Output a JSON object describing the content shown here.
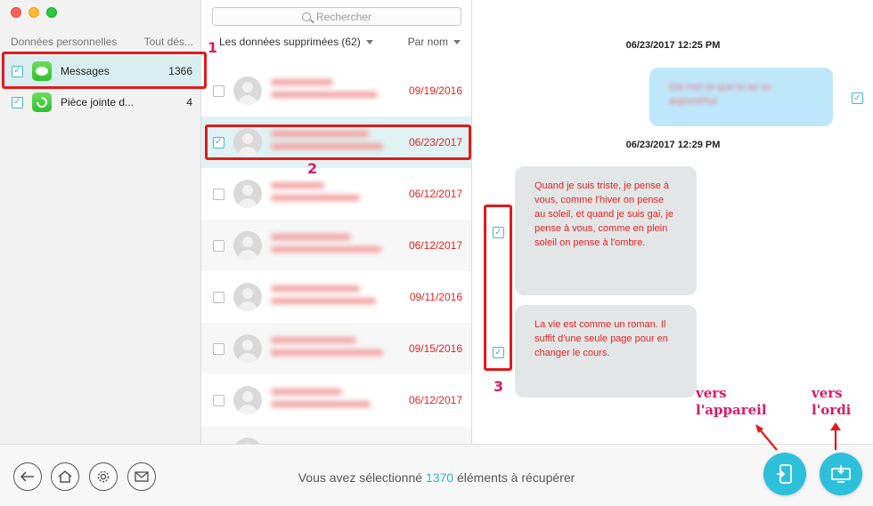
{
  "sidebar": {
    "header_left": "Données personnelles",
    "header_right": "Tout dés...",
    "items": [
      {
        "label": "Messages",
        "count": "1366"
      },
      {
        "label": "Pièce jointe d...",
        "count": "4"
      }
    ]
  },
  "list": {
    "search_placeholder": "Rechercher",
    "filter_label": "Les données supprimées (62)",
    "sort_label": "Par nom",
    "rows": [
      {
        "date": "09/19/2016"
      },
      {
        "date": "06/23/2017"
      },
      {
        "date": "06/12/2017"
      },
      {
        "date": "06/12/2017"
      },
      {
        "date": "09/11/2016"
      },
      {
        "date": "09/15/2016"
      },
      {
        "date": "06/12/2017"
      }
    ]
  },
  "conversation": {
    "timestamp_1": "06/23/2017 12:25 PM",
    "timestamp_2": "06/23/2017 12:29 PM",
    "outgoing_text": "Dis moi ce que tu as vu aujourd'hui",
    "message_1": "Quand je suis triste, je pense à vous, comme l'hiver on pense au soleil, et quand je suis gai, je pense à vous, comme en plein soleil on pense à l'ombre.",
    "message_2": "La vie est comme un roman. Il suffit d'une seule page pour en changer le cours."
  },
  "bottom": {
    "status_prefix": "Vous avez sélectionné",
    "status_count": "1370",
    "status_suffix": "éléments à récupérer"
  },
  "annotations": {
    "n1": "1",
    "n2": "2",
    "n3": "3",
    "to_device": "vers l'appareil",
    "to_computer": "vers l'ordi"
  },
  "colors": {
    "accent": "#2dc0db",
    "date_red": "#e02424",
    "annotation": "#d81b6a",
    "highlight_box": "#e01b1b"
  }
}
